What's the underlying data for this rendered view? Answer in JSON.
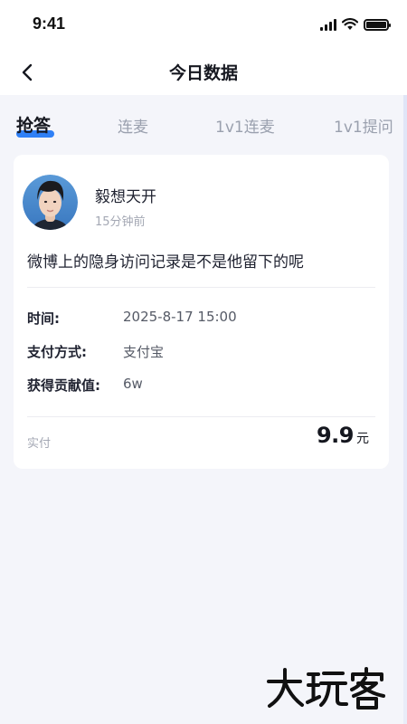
{
  "status_bar": {
    "time": "9:41"
  },
  "nav": {
    "title": "今日数据",
    "back_icon": "chevron-left-icon"
  },
  "tabs": [
    {
      "label": "抢答",
      "active": true
    },
    {
      "label": "连麦",
      "active": false
    },
    {
      "label": "1v1连麦",
      "active": false
    },
    {
      "label": "1v1提问",
      "active": false
    }
  ],
  "card": {
    "username": "毅想天开",
    "time_ago": "15分钟前",
    "question": "微博上的隐身访问记录是不是他留下的呢",
    "details": [
      {
        "label": "时间:",
        "value": "2025-8-17 15:00"
      },
      {
        "label": "支付方式:",
        "value": "支付宝"
      },
      {
        "label": "获得贡献值:",
        "value": "6w"
      }
    ],
    "paid_label": "实付",
    "amount": "9.9",
    "currency": "元"
  },
  "watermark": {
    "text": "大玩客"
  },
  "colors": {
    "accent": "#2f80f6",
    "background": "#f4f5fa",
    "card": "#ffffff",
    "muted_text": "#a4a8b4"
  }
}
